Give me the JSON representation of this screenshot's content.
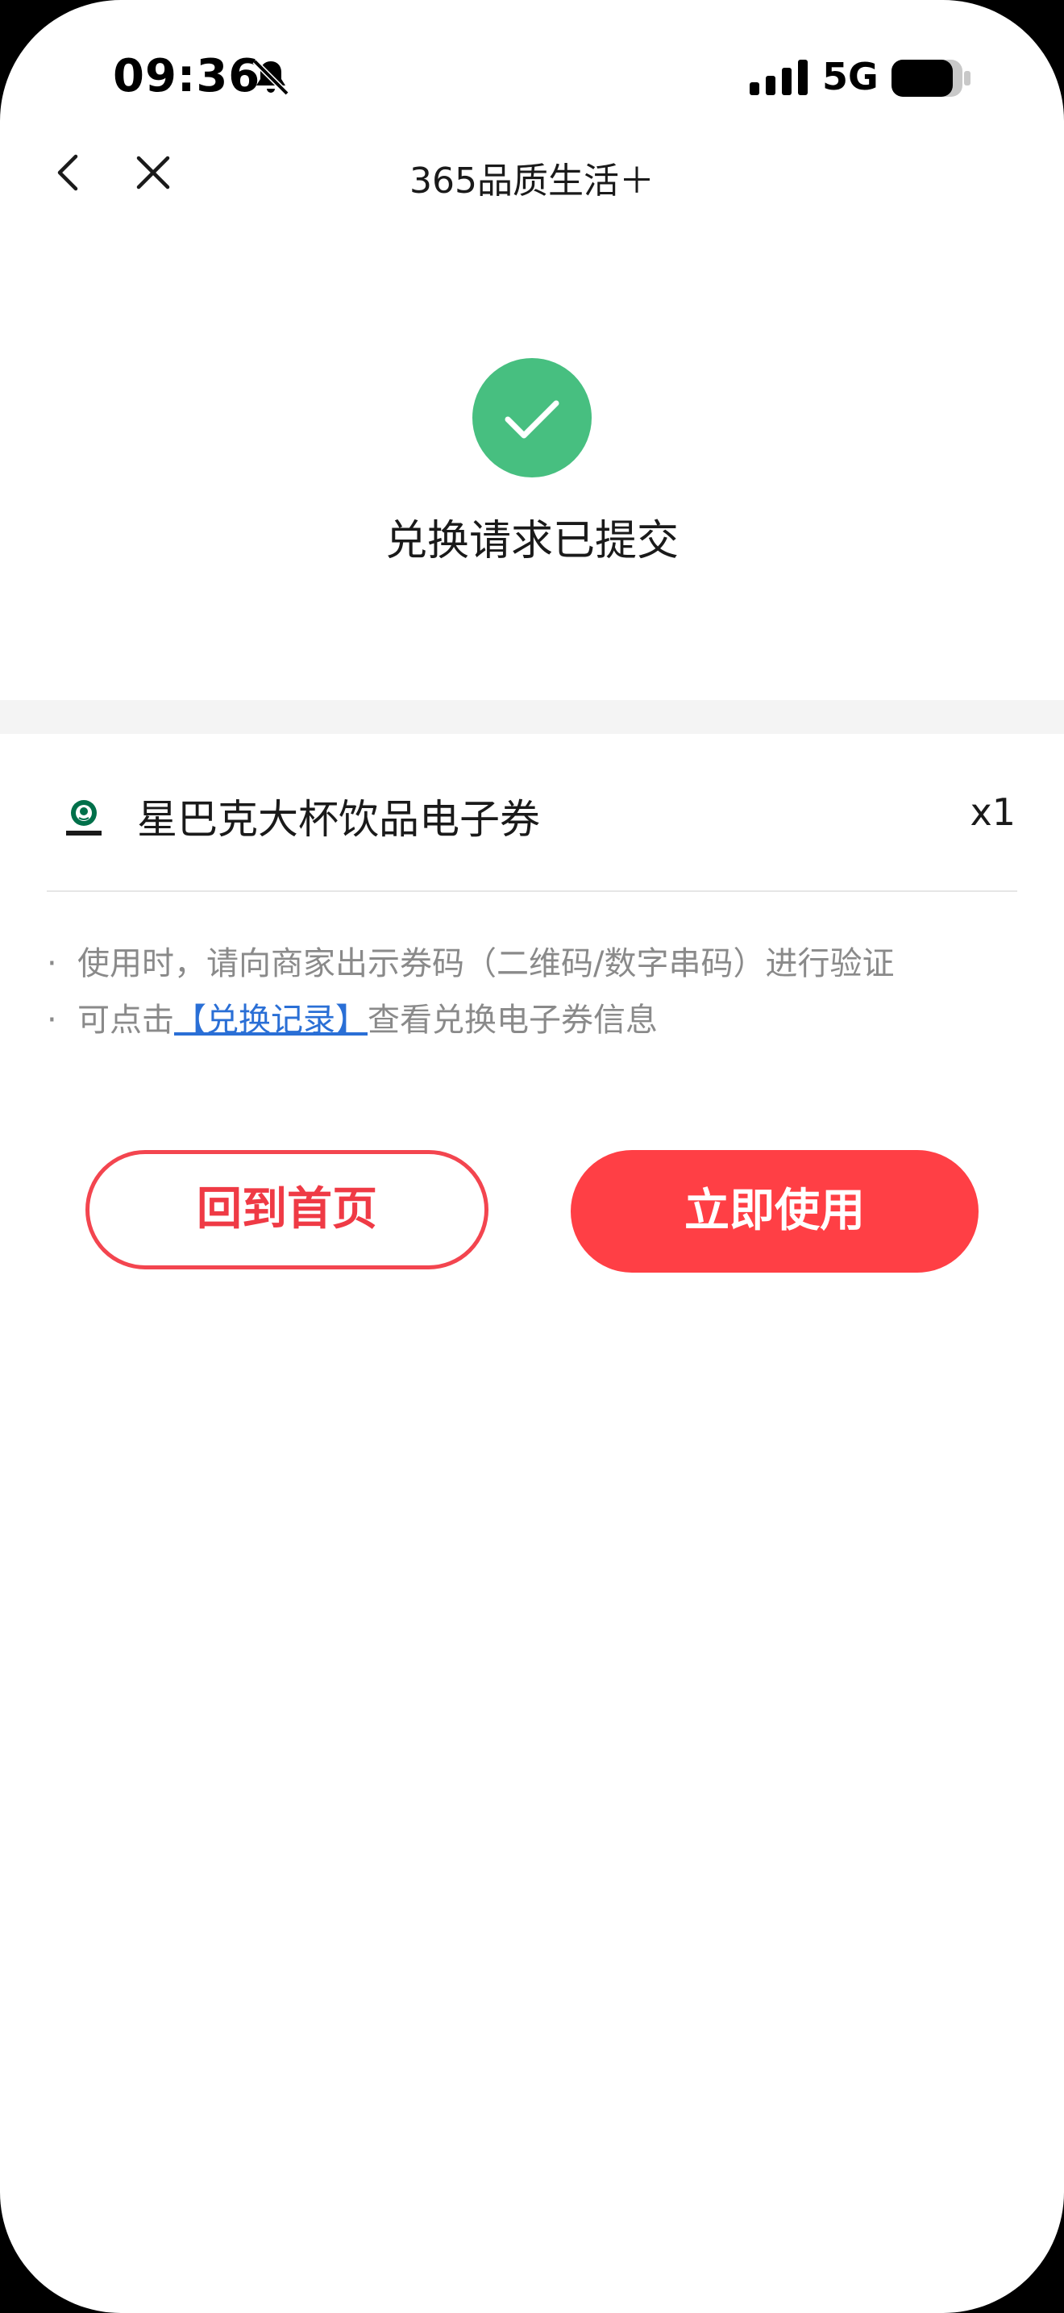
{
  "status_bar": {
    "time": "09:36",
    "network": "5G"
  },
  "nav": {
    "title": "365品质生活＋"
  },
  "success": {
    "title": "兑换请求已提交",
    "color": "#47bf80"
  },
  "item": {
    "name": "星巴克大杯饮品电子券",
    "quantity": "x1",
    "logo_icon": "starbucks-logo"
  },
  "notes": {
    "bullet": "·",
    "line1": "使用时，请向商家出示券码（二维码/数字串码）进行验证",
    "line2_prefix": "可点击",
    "line2_link": "【兑换记录】",
    "line2_suffix": "查看兑换电子券信息"
  },
  "buttons": {
    "home_label": "回到首页",
    "use_label": "立即使用",
    "accent_color": "#ff3f45"
  }
}
